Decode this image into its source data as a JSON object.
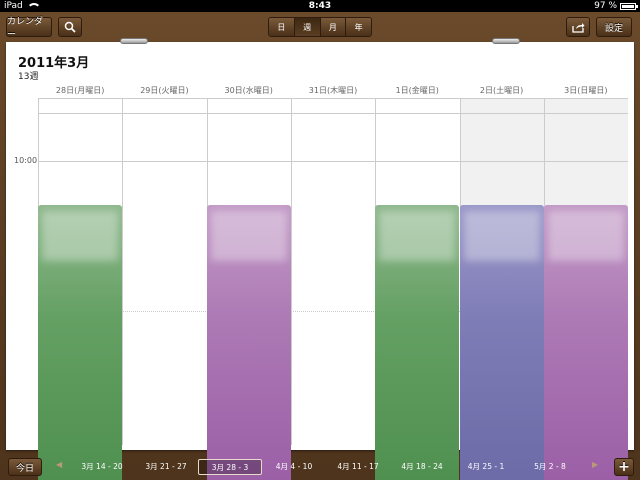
{
  "status": {
    "carrier": "iPad",
    "time": "8:43",
    "battery": "97 %",
    "battery_level": 0.97
  },
  "toolbar": {
    "calendars_label": "カレンダー",
    "views": [
      {
        "label": "日",
        "active": false
      },
      {
        "label": "週",
        "active": true
      },
      {
        "label": "月",
        "active": false
      },
      {
        "label": "年",
        "active": false
      }
    ],
    "settings_label": "設定"
  },
  "calendar": {
    "month_title": "2011年3月",
    "week_label": "13週",
    "days": [
      "28日(月曜日)",
      "29日(火曜日)",
      "30日(水曜日)",
      "31日(木曜日)",
      "1日(金曜日)",
      "2日(土曜日)",
      "3日(日曜日)"
    ],
    "time_label": "10:00",
    "events": [
      {
        "day": 0,
        "color": "green"
      },
      {
        "day": 2,
        "color": "purple"
      },
      {
        "day": 4,
        "color": "green"
      },
      {
        "day": 5,
        "color": "blue"
      },
      {
        "day": 6,
        "color": "purple"
      }
    ]
  },
  "bottom": {
    "today_label": "今日",
    "weeks": [
      "3月 14 - 20",
      "3月 21 - 27",
      "3月 28 - 3",
      "4月 4 - 10",
      "4月 11 - 17",
      "4月 18 - 24",
      "4月 25 - 1",
      "5月 2 - 8"
    ],
    "active_week": 2,
    "add_label": "+"
  },
  "icons": {
    "prev": "◀",
    "next": "▶"
  }
}
